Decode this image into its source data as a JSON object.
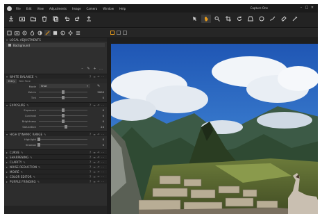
{
  "menu": {
    "items": [
      "File",
      "Edit",
      "View",
      "Adjustments",
      "Image",
      "Camera",
      "Window",
      "Help"
    ]
  },
  "window": {
    "title": "Capture One",
    "minimize": "–",
    "maximize": "□",
    "close": "×"
  },
  "toolbar": {
    "left_icons": [
      "import-icon",
      "camera-icon",
      "folder-icon",
      "trash-icon",
      "stack-icon",
      "undo-icon",
      "redo-icon",
      "export-icon"
    ],
    "cursor_tools": [
      "pan-icon",
      "hand-icon",
      "zoom-icon",
      "crop-icon",
      "rotate-icon",
      "keystone-icon",
      "spot-icon",
      "brush-icon",
      "eraser-icon",
      "picker-icon"
    ]
  },
  "tool_tabs": [
    "library-icon",
    "capture-icon",
    "lens-icon",
    "color-icon",
    "exposure-icon",
    "details-icon",
    "adjustments-icon",
    "metadata-icon",
    "output-icon",
    "batch-icon"
  ],
  "local_adjustments": {
    "title": "LOCAL ADJUSTMENTS",
    "layer": "Background",
    "tools": [
      "–",
      "✎",
      "+",
      "…"
    ]
  },
  "white_balance": {
    "title": "WHITE BALANCE",
    "tabs": [
      "Entry",
      "Skin Tone"
    ],
    "mode_label": "Mode",
    "mode_value": "Shot",
    "kelvin_label": "Kelvin",
    "kelvin_value": "5000",
    "kelvin_fraction": 0.5,
    "tint_label": "Tint",
    "tint_value": "0",
    "tint_fraction": 0.5
  },
  "exposure": {
    "title": "EXPOSURE",
    "rows": [
      {
        "label": "Exposure",
        "value": "0",
        "fraction": 0.5
      },
      {
        "label": "Contrast",
        "value": "0",
        "fraction": 0.5
      },
      {
        "label": "Brightness",
        "value": "0",
        "fraction": 0.5
      },
      {
        "label": "Saturation",
        "value": "24",
        "fraction": 0.55
      }
    ]
  },
  "hdr": {
    "title": "HIGH DYNAMIC RANGE",
    "rows": [
      {
        "label": "Highlight",
        "value": "0",
        "fraction": 0.0
      },
      {
        "label": "Shadow",
        "value": "0",
        "fraction": 0.0
      }
    ]
  },
  "collapsed_sections": [
    "CURVE",
    "SHARPENING",
    "CLARITY",
    "NOISE REDUCTION",
    "MOIRÉ",
    "COLOR EDITOR",
    "PURPLE FRINGING"
  ],
  "section_controls": [
    "?",
    "≡",
    "↶",
    "⋯"
  ],
  "chev_open": "▾",
  "chev_closed": "▸",
  "pen_glyph": "✎",
  "colors": {
    "accent": "#e79b1c",
    "panel": "#2d2d2d",
    "background": "#2b2b2b"
  }
}
